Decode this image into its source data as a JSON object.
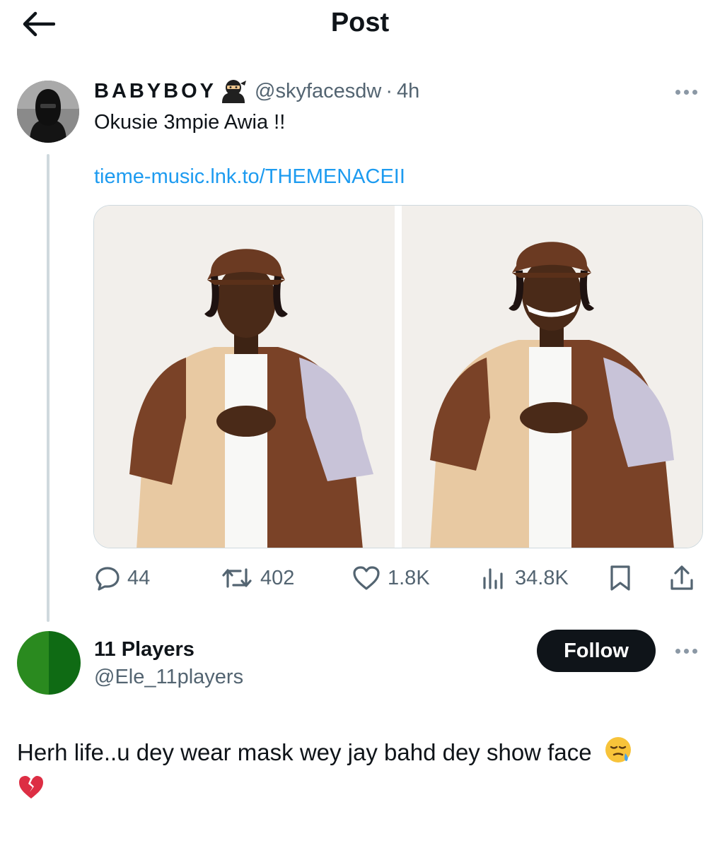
{
  "header": {
    "title": "Post",
    "back_icon": "arrow-left-icon"
  },
  "post": {
    "author_name": "BABYBOY",
    "author_badge_icon": "ninja-emoji-icon",
    "author_handle": "@skyfacesdw",
    "separator": "·",
    "time": "4h",
    "text": "Okusie 3mpie Awia !!",
    "link": "tieme-music.lnk.to/THEMENACEII",
    "media": [
      "photo-left",
      "photo-right"
    ],
    "stats": {
      "replies": "44",
      "reposts": "402",
      "likes": "1.8K",
      "views": "34.8K"
    }
  },
  "reply": {
    "author_name": "11 Players",
    "author_handle": "@Ele_11players",
    "follow_label": "Follow",
    "text": "Herh life..u dey wear mask wey jay bahd dey show face",
    "emoji_1": "sleepy-face-emoji",
    "emoji_2": "broken-heart-emoji"
  },
  "colors": {
    "link": "#1d9bf0",
    "secondary_text": "#536471",
    "primary_text": "#0f1419",
    "thread_line": "#cfd9de",
    "avatar_green_light": "#2a8a1f",
    "avatar_green_dark": "#0f6b14"
  }
}
